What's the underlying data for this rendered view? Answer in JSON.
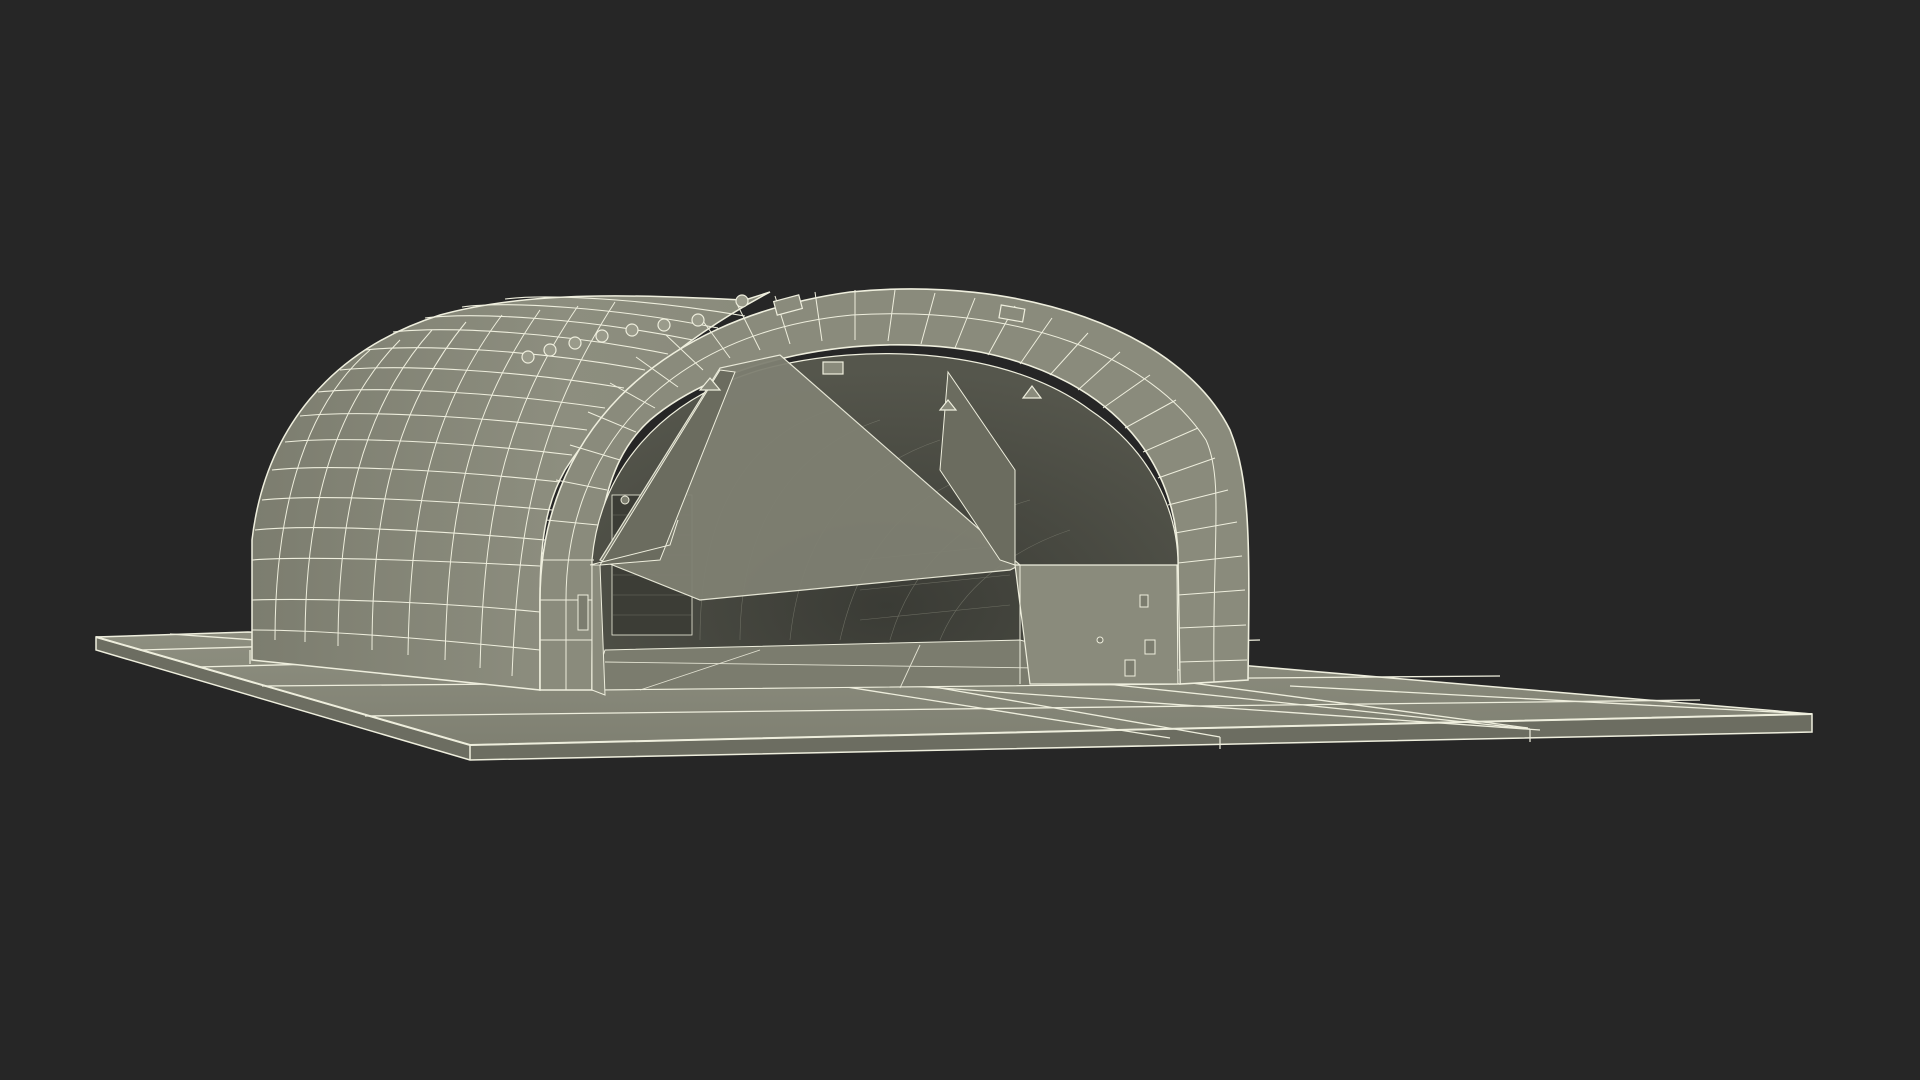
{
  "scene": {
    "subject": "aircraft-hangar-wireframe-render",
    "colors": {
      "background": "#262626",
      "surface": "#8a8b7c",
      "surface_light": "#9c9d8d",
      "surface_dark": "#6f7063",
      "interior": "#4a4b43",
      "interior_deep": "#2f302b",
      "wire": "#eeeedd"
    }
  }
}
